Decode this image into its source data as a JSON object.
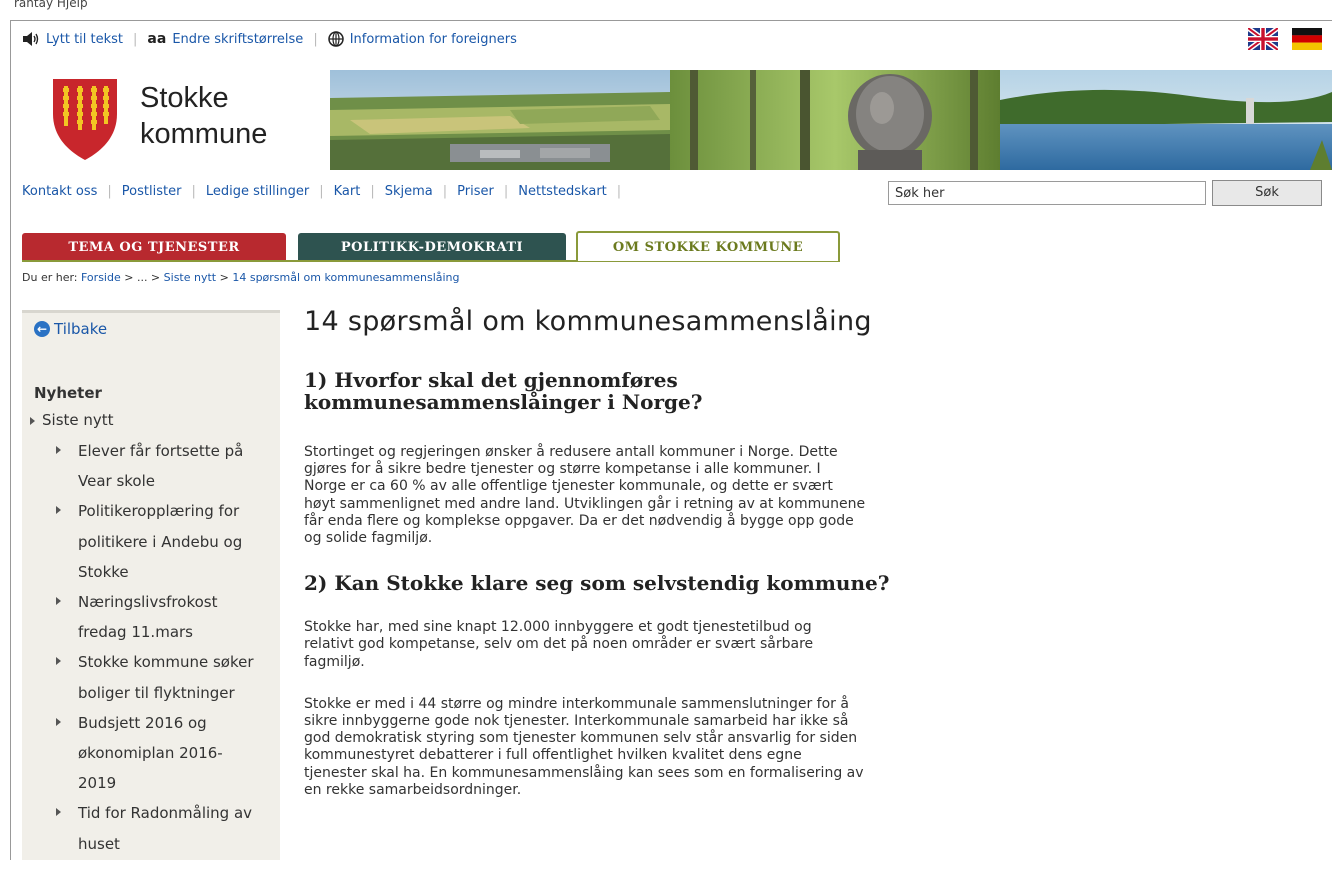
{
  "browser": {
    "menu_fragment": "rantay   Hjelp"
  },
  "utility_bar": {
    "listen_label": "Lytt til tekst",
    "font_icon_text": "aa",
    "font_size_label": "Endre skriftstørrelse",
    "foreigners_label": "Information for foreigners"
  },
  "flags": [
    {
      "icon": "uk-flag-icon"
    },
    {
      "icon": "german-flag-icon"
    }
  ],
  "logo": {
    "line1": "Stokke",
    "line2": "kommune",
    "shield_colors": [
      "#c8262c",
      "#f2c623"
    ]
  },
  "main_nav": {
    "items": [
      "Kontakt oss",
      "Postlister",
      "Ledige stillinger",
      "Kart",
      "Skjema",
      "Priser",
      "Nettstedskart"
    ],
    "search_value": "Søk her",
    "search_button": "Søk"
  },
  "tabs": [
    {
      "label": "TEMA OG TJENESTER",
      "color": "#b8292f"
    },
    {
      "label": "POLITIKK-DEMOKRATI",
      "color": "#2e5350"
    },
    {
      "label": "OM STOKKE KOMMUNE",
      "color": "#6b7a1e",
      "active": true
    }
  ],
  "breadcrumb": {
    "prefix": "Du er her:",
    "forside": "Forside",
    "ellipsis": "> ... >",
    "siste_nytt": "Siste nytt",
    "sep": ">",
    "current": "14 spørsmål om kommunesammenslåing"
  },
  "sidebar": {
    "back_label": "Tilbake",
    "heading": "Nyheter",
    "parent_item": "Siste nytt",
    "sub_items": [
      [
        "Elever får fortsette på",
        "Vear skole"
      ],
      [
        "Politikeropplæring for",
        "politikere i Andebu og",
        "Stokke"
      ],
      [
        "Næringslivsfrokost",
        "fredag 11.mars"
      ],
      [
        "Stokke kommune søker",
        "boliger til flyktninger"
      ],
      [
        "Budsjett 2016 og",
        "økonomiplan 2016-",
        "2019"
      ],
      [
        "Tid for Radonmåling av",
        "huset"
      ]
    ]
  },
  "article": {
    "title": "14 spørsmål om kommunesammenslåing",
    "q1_heading": [
      "1) Hvorfor skal det gjennomføres",
      "kommunesammenslåinger i Norge?"
    ],
    "q1_paragraph": [
      "Stortinget og regjeringen ønsker å redusere antall kommuner i Norge. Dette",
      "gjøres for å sikre bedre tjenester og større kompetanse i alle kommuner. I",
      "Norge er ca 60 % av alle offentlige tjenester kommunale, og dette er svært",
      "høyt sammenlignet med andre land. Utviklingen går i retning av at kommunene",
      "får enda flere og komplekse oppgaver. Da er det nødvendig å bygge opp gode",
      "og solide fagmiljø."
    ],
    "q2_heading": "2) Kan Stokke klare seg som selvstendig kommune?",
    "q2_paragraph1": [
      "Stokke har, med sine knapt 12.000 innbyggere et godt tjenestetilbud og",
      "relativt god kompetanse, selv om det på noen områder er svært sårbare",
      "fagmiljø."
    ],
    "q2_paragraph2": [
      "Stokke er med i 44 større og mindre interkommunale sammenslutninger for å",
      "sikre innbyggerne gode nok tjenester. Interkommunale samarbeid har ikke så",
      "god demokratisk styring som tjenester kommunen selv står ansvarlig for siden",
      "kommunestyret debatterer i full offentlighet hvilken kvalitet dens egne",
      "tjenester skal ha. En kommunesammenslåing kan sees som en formalisering av",
      "en rekke samarbeidsordninger."
    ]
  },
  "colors": {
    "link": "#1a57a8",
    "sidebar_bg": "#f1efe9",
    "accent_green": "#8a9a3a"
  }
}
